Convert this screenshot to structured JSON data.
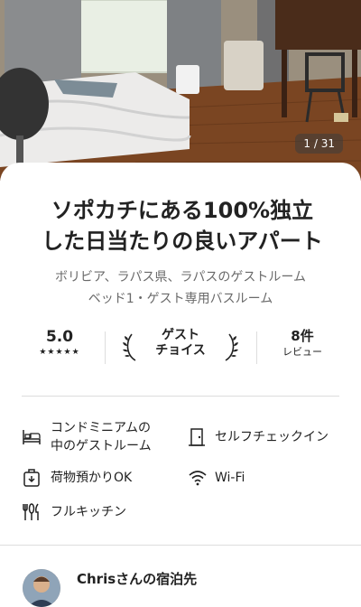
{
  "gallery": {
    "counter": "1 / 31"
  },
  "listing": {
    "title_line1": "ソポカチにある100%独立",
    "title_line2": "した日当たりの良いアパート",
    "location": "ボリビア、ラパス県、ラパスのゲストルーム",
    "details": "ベッド1・ゲスト専用バスルーム"
  },
  "stats": {
    "rating": "5.0",
    "stars": "★★★★★",
    "guest_choice_line1": "ゲスト",
    "guest_choice_line2": "チョイス",
    "reviews_count": "8件",
    "reviews_label": "レビュー"
  },
  "amenities": {
    "room_type_line1": "コンドミニアムの",
    "room_type_line2": "中のゲストルーム",
    "self_checkin": "セルフチェックイン",
    "luggage": "荷物預かりOK",
    "wifi": "Wi-Fi",
    "kitchen": "フルキッチン"
  },
  "host": {
    "title": "Chrisさんの宿泊先"
  },
  "icons": [
    "bed-icon",
    "door-icon",
    "luggage-icon",
    "wifi-icon",
    "kitchen-icon",
    "laurel-left-icon",
    "laurel-right-icon"
  ]
}
